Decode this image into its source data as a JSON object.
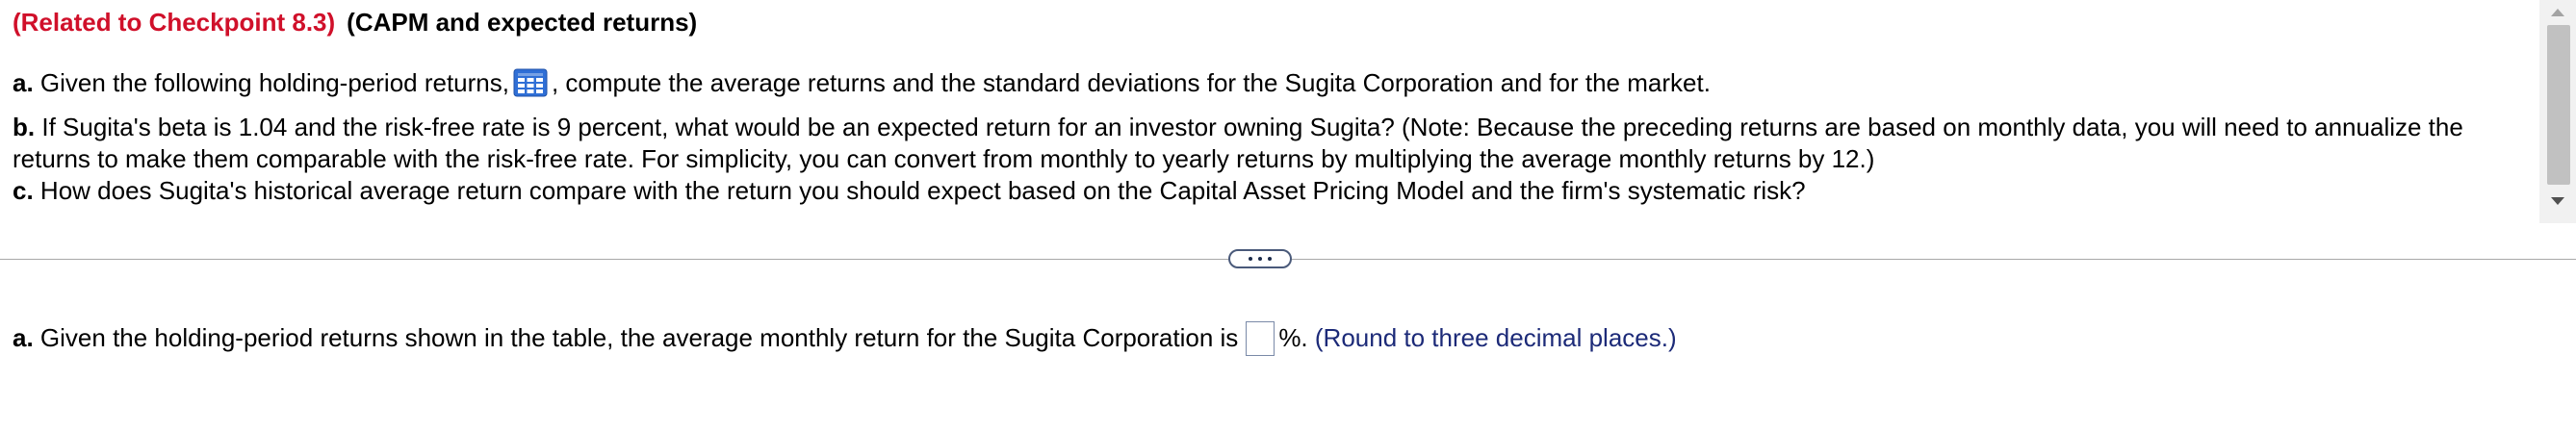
{
  "question": {
    "related": "(Related to Checkpoint 8.3)",
    "title": "(CAPM and expected returns)",
    "part_a": {
      "label": "a.",
      "text_before_icon": "Given the following holding-period returns,",
      "text_after_icon": ", compute the average returns and the standard deviations for the Sugita Corporation and for the market."
    },
    "part_b": {
      "label": "b.",
      "line1": "If Sugita's beta is 1.04 and the risk-free rate is 9 percent, what would be an expected return for an investor owning Sugita?  (Note:  Because the preceding returns are based on monthly data, you will need to annualize the",
      "line2": "returns to make them comparable with the risk-free rate.  For simplicity, you can convert from monthly to yearly returns by multiplying the average monthly returns by 12.)"
    },
    "part_c": {
      "label": "c.",
      "text": "How does Sugita's historical average return compare with the return you should expect based on the Capital Asset Pricing Model and the firm's systematic risk?"
    },
    "table_icon": "table-grid-icon"
  },
  "answer": {
    "label": "a.",
    "text_before_input": "Given the holding-period returns shown in the table, the average monthly return for the Sugita Corporation is",
    "input_value": "",
    "suffix": "%.",
    "hint": "(Round to three decimal places.)"
  },
  "colors": {
    "related": "#d0102a",
    "hint": "#1c2a78",
    "icon_blue": "#2f6fd6"
  },
  "icons": {
    "scroll_up": "triangle-up-icon",
    "scroll_down": "triangle-down-icon",
    "expand": "ellipsis-icon"
  }
}
